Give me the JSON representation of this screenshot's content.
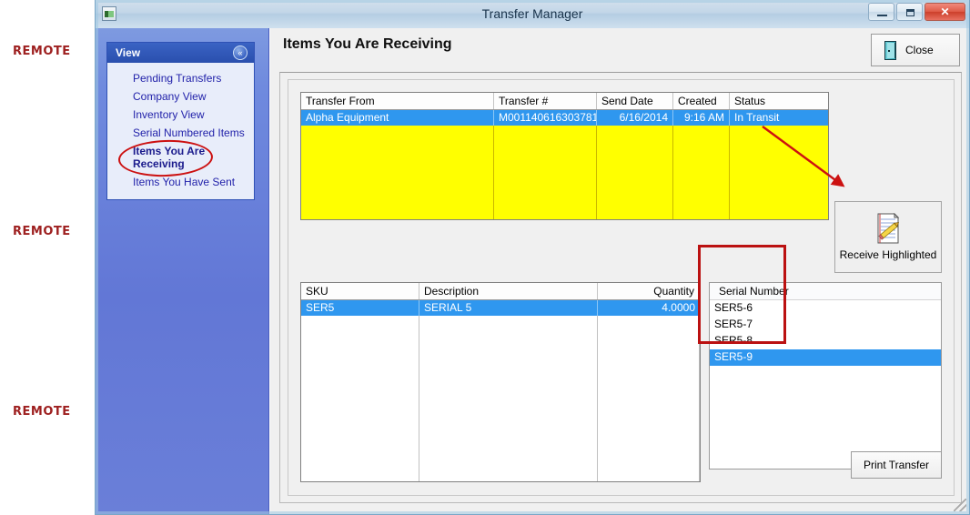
{
  "watermarks": [
    "REMOTE",
    "REMOTE",
    "REMOTE"
  ],
  "window": {
    "title": "Transfer Manager",
    "app_icon": "app-window-icon",
    "controls": {
      "minimize": "minimize-icon",
      "maximize": "maximize-icon",
      "close": "✕"
    }
  },
  "sidebar": {
    "panel_title": "View",
    "collapse_icon": "«",
    "items": [
      {
        "label": "Pending Transfers",
        "current": false
      },
      {
        "label": "Company View",
        "current": false
      },
      {
        "label": "Inventory View",
        "current": false
      },
      {
        "label": "Serial Numbered Items",
        "current": false
      },
      {
        "label": "Items You Are\nReceiving",
        "current": true
      },
      {
        "label": "Items You Have Sent",
        "current": false
      }
    ]
  },
  "header": {
    "page_title": "Items You Are Receiving",
    "close_label": "Close"
  },
  "transfers_grid": {
    "columns": [
      "Transfer From",
      "Transfer #",
      "Send Date",
      "Created",
      "Status"
    ],
    "rows": [
      {
        "transfer_from": "Alpha Equipment",
        "transfer_number": "M001140616303781",
        "send_date": "6/16/2014",
        "created": "9:16 AM",
        "status": "In Transit",
        "selected": true
      }
    ]
  },
  "receive_button": {
    "label": "Receive Highlighted",
    "icon": "notepad-pencil-icon"
  },
  "items_grid": {
    "columns": [
      "SKU",
      "Description",
      "Quantity"
    ],
    "rows": [
      {
        "sku": "SER5",
        "description": "SERIAL 5",
        "quantity": "4.0000",
        "selected": true
      }
    ]
  },
  "serial_grid": {
    "column": "Serial Number",
    "rows": [
      {
        "serial": "SER5-6",
        "selected": false
      },
      {
        "serial": "SER5-7",
        "selected": false
      },
      {
        "serial": "SER5-8",
        "selected": false
      },
      {
        "serial": "SER5-9",
        "selected": true
      }
    ]
  },
  "print_button": {
    "label": "Print Transfer"
  },
  "colors": {
    "selection_blue": "#2f97ef",
    "grid_yellow": "#ffff00",
    "annotation_red": "#bb1111",
    "sidebar_blue": "#6277d6",
    "watermark_red": "#9e2020"
  }
}
